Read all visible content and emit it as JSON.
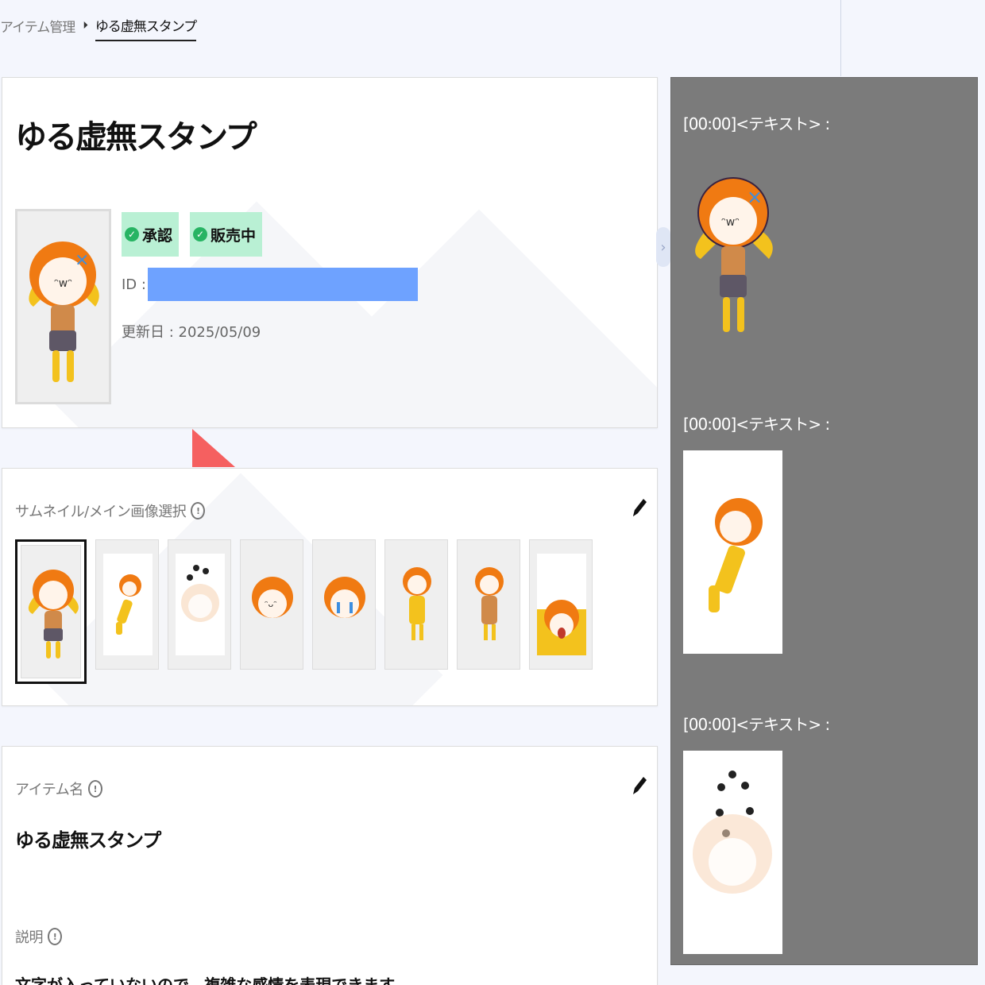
{
  "breadcrumb": {
    "parent": "アイテム管理",
    "separator": "⏵",
    "current": "ゆる虚無スタンプ"
  },
  "item": {
    "title": "ゆる虚無スタンプ",
    "badges": [
      {
        "label": "承認",
        "icon": "check-circle-icon"
      },
      {
        "label": "販売中",
        "icon": "check-circle-icon"
      }
    ],
    "id_label": "ID :",
    "updated_label": "更新日 : 2025/05/09"
  },
  "thumbnails": {
    "label": "サムネイル/メイン画像選択",
    "info_icon": "!",
    "edit_icon": "pencil-icon",
    "items": [
      {
        "name": "stamp-jump",
        "selected": true
      },
      {
        "name": "stamp-lying"
      },
      {
        "name": "stamp-faded-dots"
      },
      {
        "name": "stamp-smile-face"
      },
      {
        "name": "stamp-crying-face"
      },
      {
        "name": "stamp-standing"
      },
      {
        "name": "stamp-standing-closed-eyes"
      },
      {
        "name": "stamp-hands-up"
      }
    ]
  },
  "item_name": {
    "label": "アイテム名",
    "info_icon": "!",
    "value": "ゆる虚無スタンプ"
  },
  "description": {
    "label": "説明",
    "info_icon": "!",
    "value": "文字が入っていないので、複雑な感情を表現できます。"
  },
  "chat_preview": {
    "messages": [
      {
        "label": "[00:00]<テキスト> :"
      },
      {
        "label": "[00:00]<テキスト> :"
      },
      {
        "label": "[00:00]<テキスト> :"
      }
    ]
  },
  "colors": {
    "accent_green": "#b9f0d4",
    "id_mask": "#6ea2ff",
    "chat_bg": "#7b7b7b",
    "hair": "#f07a12",
    "jacket": "#f3c21d",
    "hair_clip": "#3d8ee0"
  }
}
